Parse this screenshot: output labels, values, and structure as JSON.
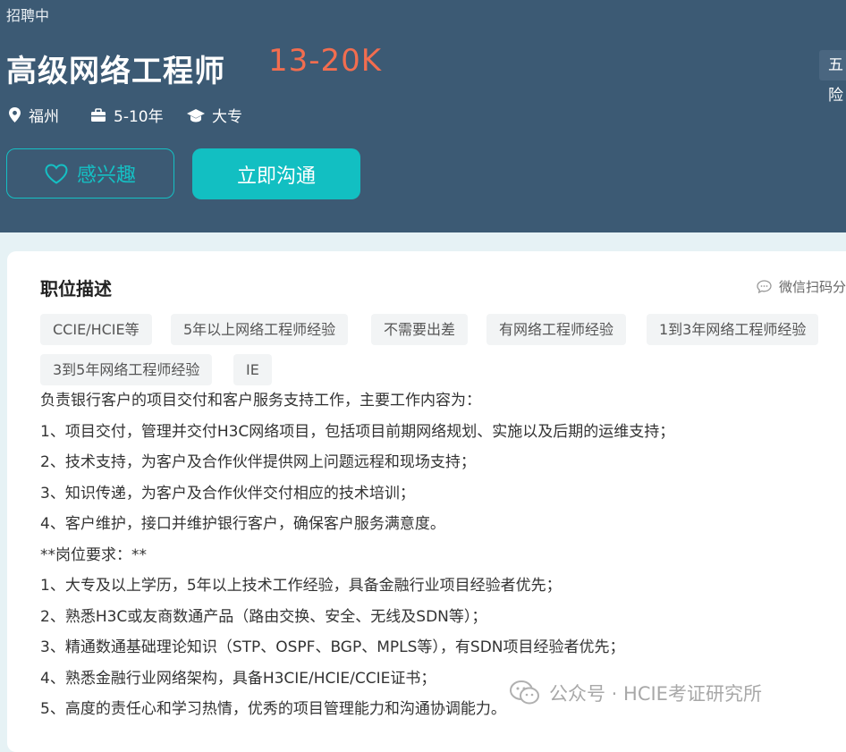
{
  "header": {
    "status": "招聘中",
    "title": "高级网络工程师",
    "salary": "13-20K",
    "right_tag": "五险",
    "location": "福州",
    "experience": "5-10年",
    "education": "大专",
    "like_label": "感兴趣",
    "chat_label": "立即沟通"
  },
  "card": {
    "section_title": "职位描述",
    "share_label": "微信扫码分享",
    "tags": [
      "CCIE/HCIE等",
      "5年以上网络工程师经验",
      "不需要出差",
      "有网络工程师经验",
      "1到3年网络工程师经验",
      "3到5年网络工程师经验",
      "IE"
    ],
    "lines": [
      "负责银行客户的项目交付和客户服务支持工作，主要工作内容为：",
      "1、项目交付，管理并交付H3C网络项目，包括项目前期网络规划、实施以及后期的运维支持；",
      "2、技术支持，为客户及合作伙伴提供网上问题远程和现场支持；",
      "3、知识传递，为客户及合作伙伴交付相应的技术培训；",
      "4、客户维护，接口并维护银行客户，确保客户服务满意度。",
      "**岗位要求：**",
      "1、大专及以上学历，5年以上技术工作经验，具备金融行业项目经验者优先；",
      "2、熟悉H3C或友商数通产品（路由交换、安全、无线及SDN等）；",
      "3、精通数通基础理论知识（STP、OSPF、BGP、MPLS等），有SDN项目经验者优先；",
      "4、熟悉金融行业网络架构，具备H3CIE/HCIE/CCIE证书；",
      "5、高度的责任心和学习热情，优秀的项目管理能力和沟通协调能力。"
    ]
  },
  "watermark": "公众号 · HCIE考证研究所",
  "colors": {
    "header_bg": "#3c5a74",
    "accent": "#12bfc2",
    "salary": "#f26d4f"
  }
}
